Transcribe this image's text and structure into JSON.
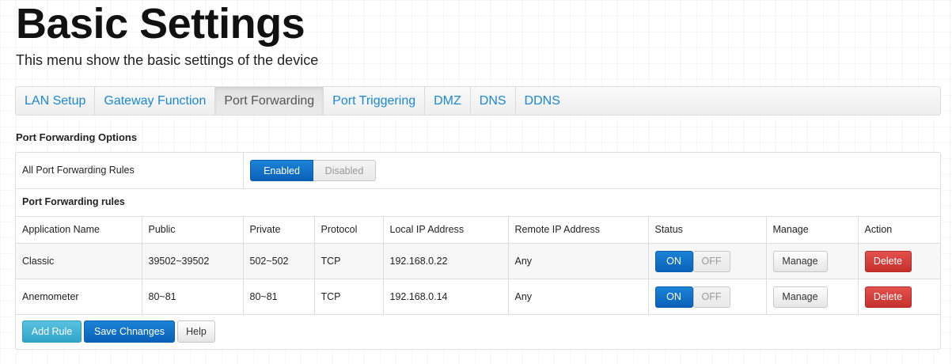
{
  "header": {
    "title": "Basic Settings",
    "subtitle": "This menu show the basic settings of the device"
  },
  "tabs": [
    {
      "label": "LAN Setup",
      "active": false
    },
    {
      "label": "Gateway Function",
      "active": false
    },
    {
      "label": "Port Forwarding",
      "active": true
    },
    {
      "label": "Port Triggering",
      "active": false
    },
    {
      "label": "DMZ",
      "active": false
    },
    {
      "label": "DNS",
      "active": false
    },
    {
      "label": "DDNS",
      "active": false
    }
  ],
  "options": {
    "section_title": "Port Forwarding Options",
    "all_rules_label": "All Port Forwarding Rules",
    "enabled_label": "Enabled",
    "disabled_label": "Disabled",
    "selected": "Enabled"
  },
  "rules": {
    "title": "Port Forwarding rules",
    "columns": [
      "Application Name",
      "Public",
      "Private",
      "Protocol",
      "Local IP Address",
      "Remote IP Address",
      "Status",
      "Manage",
      "Action"
    ],
    "rows": [
      {
        "application_name": "Classic",
        "public": "39502~39502",
        "private": "502~502",
        "protocol": "TCP",
        "local_ip": "192.168.0.22",
        "remote_ip": "Any",
        "status_on": "ON",
        "status_off": "OFF",
        "status": "ON",
        "manage_label": "Manage",
        "action_label": "Delete"
      },
      {
        "application_name": "Anemometer",
        "public": "80~81",
        "private": "80~81",
        "protocol": "TCP",
        "local_ip": "192.168.0.14",
        "remote_ip": "Any",
        "status_on": "ON",
        "status_off": "OFF",
        "status": "ON",
        "manage_label": "Manage",
        "action_label": "Delete"
      }
    ]
  },
  "footer": {
    "add_rule_label": "Add Rule",
    "save_label": "Save Chnanges",
    "help_label": "Help"
  },
  "colors": {
    "link": "#1a87d6",
    "primary": "#0a62b8",
    "info": "#2fa4cc",
    "danger": "#c5302c"
  }
}
